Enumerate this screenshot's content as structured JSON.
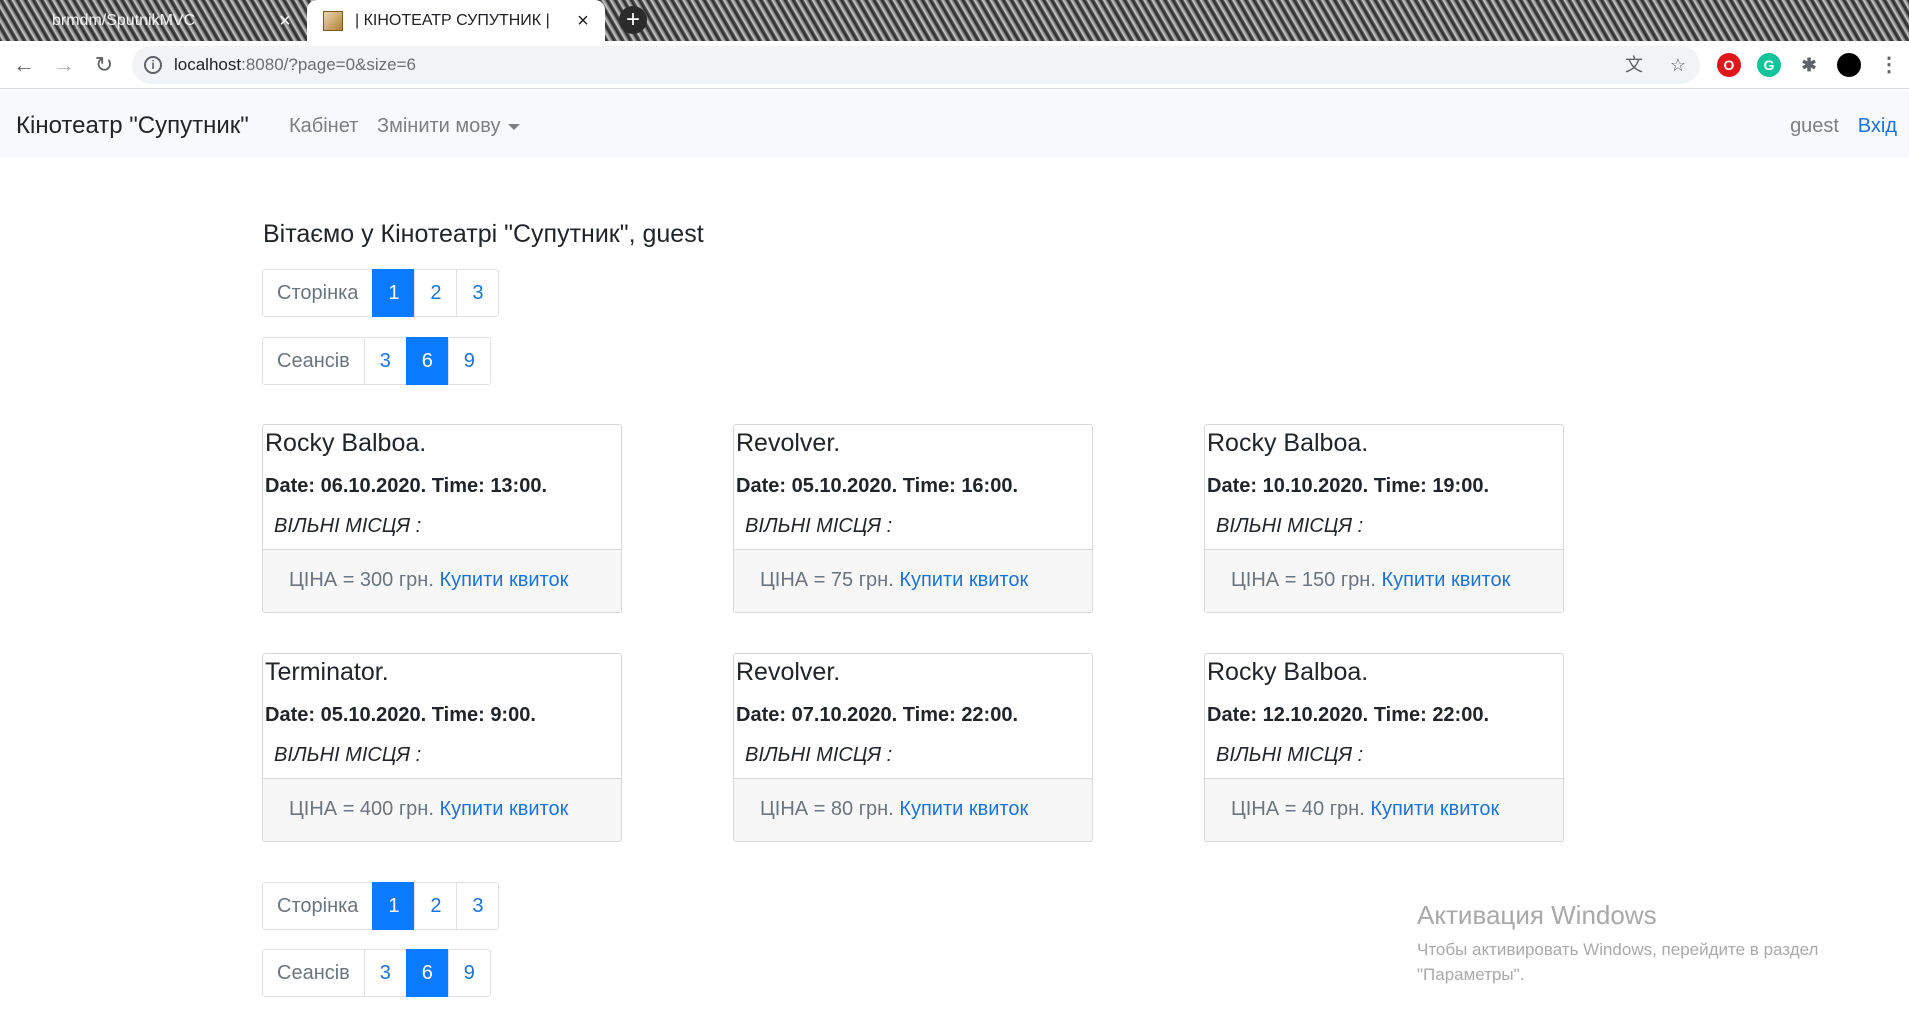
{
  "browser": {
    "tabs": [
      {
        "title": "brmdm/SputnikMVC",
        "close": "×"
      },
      {
        "title": "| КІНОТЕАТР СУПУТНИК |",
        "close": "×"
      }
    ],
    "new_tab": "+",
    "url_host": "localhost",
    "url_rest": ":8080/?page=0&size=6"
  },
  "navbar": {
    "brand": "Кінотеатр \"Супутник\"",
    "cabinet": "Кабінет",
    "change_language": "Змінити мову",
    "user": "guest",
    "login": "Вхід"
  },
  "welcome": "Вітаємо у Кінотеатрі \"Супутник\", guest",
  "pager": {
    "page_label": "Сторінка",
    "pages": [
      "1",
      "2",
      "3"
    ],
    "active_page": 0,
    "size_label": "Сеансів",
    "sizes": [
      "3",
      "6",
      "9"
    ],
    "active_size": 1
  },
  "sessions": [
    {
      "title": "Rocky Balboa.",
      "datetime": "Date: 06.10.2020. Time: 13:00.",
      "seats": "ВІЛЬНІ МІСЦЯ :",
      "price": "ЦІНА = 300 грн.",
      "buy": "Купити квиток"
    },
    {
      "title": "Revolver.",
      "datetime": "Date: 05.10.2020. Time: 16:00.",
      "seats": "ВІЛЬНІ МІСЦЯ :",
      "price": "ЦІНА = 75 грн.",
      "buy": "Купити квиток"
    },
    {
      "title": "Rocky Balboa.",
      "datetime": "Date: 10.10.2020. Time: 19:00.",
      "seats": "ВІЛЬНІ МІСЦЯ :",
      "price": "ЦІНА = 150 грн.",
      "buy": "Купити квиток"
    },
    {
      "title": "Terminator.",
      "datetime": "Date: 05.10.2020. Time: 9:00.",
      "seats": "ВІЛЬНІ МІСЦЯ :",
      "price": "ЦІНА = 400 грн.",
      "buy": "Купити квиток"
    },
    {
      "title": "Revolver.",
      "datetime": "Date: 07.10.2020. Time: 22:00.",
      "seats": "ВІЛЬНІ МІСЦЯ :",
      "price": "ЦІНА = 80 грн.",
      "buy": "Купити квиток"
    },
    {
      "title": "Rocky Balboa.",
      "datetime": "Date: 12.10.2020. Time: 22:00.",
      "seats": "ВІЛЬНІ МІСЦЯ :",
      "price": "ЦІНА = 40 грн.",
      "buy": "Купити квиток"
    }
  ],
  "windows_activation": {
    "title": "Активация Windows",
    "text": "Чтобы активировать Windows, перейдите в раздел \"Параметры\"."
  }
}
